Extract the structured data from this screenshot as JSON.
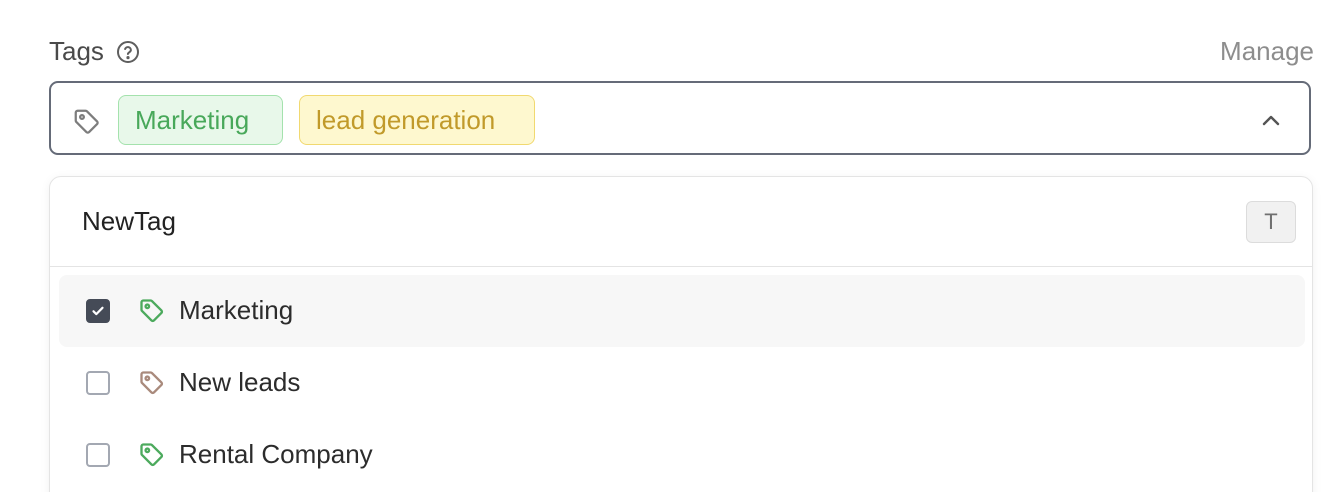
{
  "field": {
    "label": "Tags",
    "help_icon": "question-circle-icon",
    "manage_label": "Manage"
  },
  "select": {
    "icon": "tag-icon",
    "chips": [
      {
        "label": "Marketing",
        "color": "#48a85a"
      },
      {
        "label": "lead generation",
        "color": "#c19a2a"
      }
    ],
    "toggle_icon": "chevron-up-icon"
  },
  "dropdown": {
    "search": {
      "value": "NewTag",
      "placeholder": ""
    },
    "shortcut": "T",
    "options": [
      {
        "label": "Marketing",
        "checked": true,
        "tag_color": "#4caa5d"
      },
      {
        "label": "New leads",
        "checked": false,
        "tag_color": "#a98a7c"
      },
      {
        "label": "Rental Company",
        "checked": false,
        "tag_color": "#4caa5d"
      }
    ]
  }
}
